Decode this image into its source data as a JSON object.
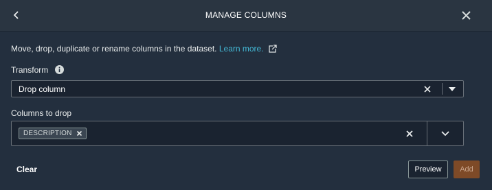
{
  "header": {
    "title": "MANAGE COLUMNS",
    "back_icon": "chevron-left-icon",
    "close_icon": "close-icon"
  },
  "description": {
    "text": "Move, drop, duplicate or rename columns in the dataset.",
    "link_text": "Learn more.",
    "link_icon": "external-link-icon"
  },
  "transform": {
    "label": "Transform",
    "info_icon": "info-icon",
    "value": "Drop column"
  },
  "columns_to_drop": {
    "label": "Columns to drop",
    "tokens": [
      "DESCRIPTION"
    ]
  },
  "footer": {
    "clear_label": "Clear",
    "preview_label": "Preview",
    "add_label": "Add"
  },
  "colors": {
    "background": "#232f3e",
    "link": "#44b9d6",
    "add_button": "#7e4a27"
  }
}
